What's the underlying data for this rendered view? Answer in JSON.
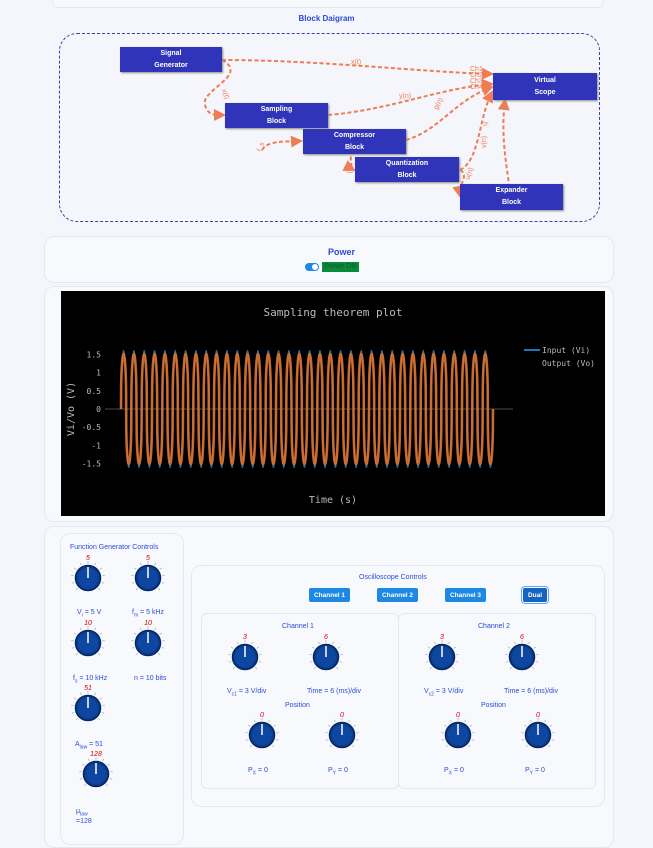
{
  "block_diagram": {
    "title": "Block Daigram",
    "blocks": {
      "signal_generator": "Signal\nGenerator",
      "sampling": "Sampling\nBlock",
      "compressor": "Compressor\nBlock",
      "quantization": "Quantization\nBlock",
      "expander": "Expander\nBlock",
      "scope": "Virtual\nScope"
    },
    "signals": {
      "xt": "x(t)",
      "xt2": "x(t)",
      "yn": "y(n)",
      "fs": "f_s",
      "gn": "g(n)",
      "fn": "f(n)",
      "ch1": "Ch1",
      "ch2": "Ch2",
      "ch3": "Ch3",
      "ch4": "Ch4",
      "un": "u(n)",
      "vn": "v(n)",
      "h": "h"
    }
  },
  "power": {
    "title": "Power",
    "toggle_on": true,
    "button_label": "Power ON"
  },
  "plot": {
    "colors": {
      "input": "#1f77b4",
      "output": "#e8742a",
      "bg": "#000000"
    }
  },
  "chart_data": {
    "type": "line",
    "title": "Sampling theorem plot",
    "xlabel": "Time (s)",
    "ylabel": "Vi/Vo (V)",
    "ylim": [
      -1.7,
      1.7
    ],
    "yticks": [
      "1.5",
      "1",
      "0.5",
      "0",
      "-0.5",
      "-1",
      "-1.5"
    ],
    "ytick_values": [
      1.5,
      1,
      0.5,
      0,
      -0.5,
      -1,
      -1.5
    ],
    "grid": false,
    "legend_position": "top-right",
    "series": [
      {
        "name": "Input (Vi)",
        "amplitude": 1.6,
        "cycles": 36
      },
      {
        "name": "Output (Vo)",
        "amplitude": 1.5,
        "cycles": 36
      }
    ]
  },
  "fg": {
    "title": "Function Generator Controls",
    "k1": "5",
    "k2": "5",
    "k3": "10",
    "k4": "10",
    "k5": "51",
    "k6": "128",
    "vi": "V",
    "vi_sub": "i",
    "vi_val": " = 5 V",
    "fm": "f",
    "fm_sub": "m",
    "fm_val": " = 5 kHz",
    "fs": "f",
    "fs_sub": "s",
    "fs_val": " = 10 kHz",
    "n": "n = 10 bits",
    "a": "A",
    "a_sub": "law",
    "a_val": " = 51",
    "mu": "μ",
    "mu_sub": "law",
    "mu_val": "=128"
  },
  "osc": {
    "title": "Oscilloscope Controls",
    "buttons": [
      "Channel 1",
      "Channel 2",
      "Channel 3",
      "Dual"
    ],
    "ch1": {
      "title": "Channel 1",
      "volts_knob": "3",
      "time_knob": "6",
      "v": "V",
      "v_sub": "c1",
      "v_val": " = 3 V/div",
      "time": "Time = 6 (ms)/div",
      "pos": "Position",
      "px_knob": "0",
      "py_knob": "0",
      "px": "P",
      "px_sub": "X",
      "px_val": " = 0",
      "py": "P",
      "py_sub": "Y",
      "py_val": " = 0"
    },
    "ch2": {
      "title": "Channel 2",
      "volts_knob": "3",
      "time_knob": "6",
      "v": "V",
      "v_sub": "c2",
      "v_val": " = 3 V/div",
      "time": "Time = 6 (ms)/div",
      "pos": "Position",
      "px_knob": "0",
      "py_knob": "0",
      "px": "P",
      "px_sub": "X",
      "px_val": " = 0",
      "py": "P",
      "py_sub": "Y",
      "py_val": " = 0"
    }
  }
}
